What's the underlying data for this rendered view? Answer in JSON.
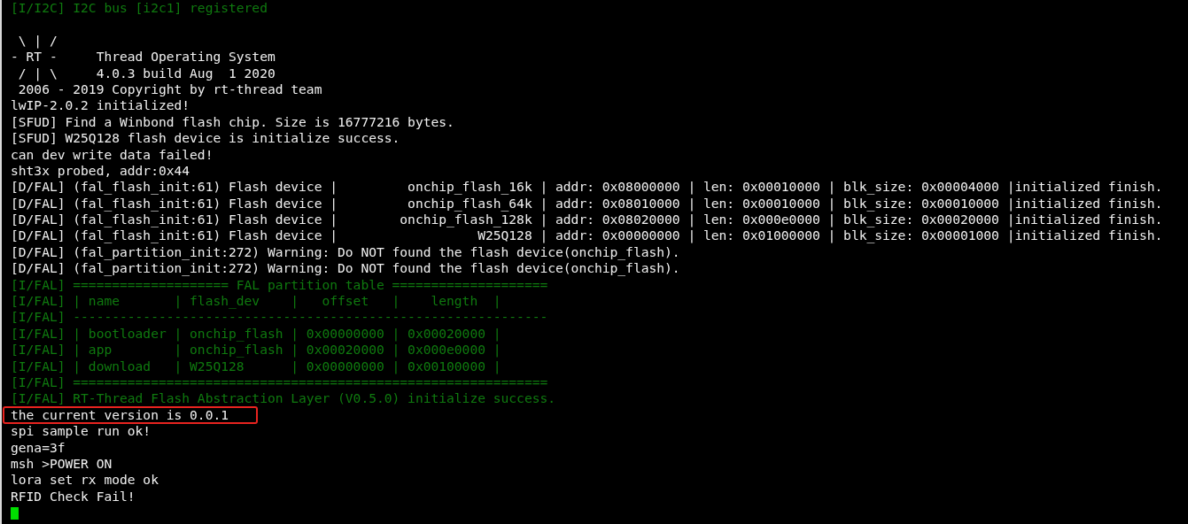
{
  "terminal": {
    "lines": [
      {
        "kind": "info",
        "text": "[I/I2C] I2C bus [i2c1] registered",
        "highlighted": false
      },
      {
        "kind": "blank"
      },
      {
        "kind": "output",
        "text": " \\ | /",
        "highlighted": false
      },
      {
        "kind": "output",
        "text": "- RT -     Thread Operating System",
        "highlighted": false
      },
      {
        "kind": "output",
        "text": " / | \\     4.0.3 build Aug  1 2020",
        "highlighted": false
      },
      {
        "kind": "output",
        "text": " 2006 - 2019 Copyright by rt-thread team",
        "highlighted": false
      },
      {
        "kind": "output",
        "text": "lwIP-2.0.2 initialized!",
        "highlighted": false
      },
      {
        "kind": "output",
        "text": "[SFUD] Find a Winbond flash chip. Size is 16777216 bytes.",
        "highlighted": false
      },
      {
        "kind": "output",
        "text": "[SFUD] W25Q128 flash device is initialize success.",
        "highlighted": false
      },
      {
        "kind": "output",
        "text": "can dev write data failed!",
        "highlighted": false
      },
      {
        "kind": "output",
        "text": "sht3x probed, addr:0x44",
        "highlighted": false
      },
      {
        "kind": "output",
        "text": "[D/FAL] (fal_flash_init:61) Flash device |         onchip_flash_16k | addr: 0x08000000 | len: 0x00010000 | blk_size: 0x00004000 |initialized finish.",
        "highlighted": false
      },
      {
        "kind": "output",
        "text": "[D/FAL] (fal_flash_init:61) Flash device |         onchip_flash_64k | addr: 0x08010000 | len: 0x00010000 | blk_size: 0x00010000 |initialized finish.",
        "highlighted": false
      },
      {
        "kind": "output",
        "text": "[D/FAL] (fal_flash_init:61) Flash device |        onchip_flash_128k | addr: 0x08020000 | len: 0x000e0000 | blk_size: 0x00020000 |initialized finish.",
        "highlighted": false
      },
      {
        "kind": "output",
        "text": "[D/FAL] (fal_flash_init:61) Flash device |                  W25Q128 | addr: 0x00000000 | len: 0x01000000 | blk_size: 0x00001000 |initialized finish.",
        "highlighted": false
      },
      {
        "kind": "output",
        "text": "[D/FAL] (fal_partition_init:272) Warning: Do NOT found the flash device(onchip_flash).",
        "highlighted": false
      },
      {
        "kind": "output",
        "text": "[D/FAL] (fal_partition_init:272) Warning: Do NOT found the flash device(onchip_flash).",
        "highlighted": false
      },
      {
        "kind": "info",
        "text": "[I/FAL] ==================== FAL partition table ====================",
        "highlighted": false
      },
      {
        "kind": "info",
        "text": "[I/FAL] | name       | flash_dev    |   offset   |    length  |",
        "highlighted": false
      },
      {
        "kind": "info",
        "text": "[I/FAL] -------------------------------------------------------------",
        "highlighted": false
      },
      {
        "kind": "info",
        "text": "[I/FAL] | bootloader | onchip_flash | 0x00000000 | 0x00020000 |",
        "highlighted": false
      },
      {
        "kind": "info",
        "text": "[I/FAL] | app        | onchip_flash | 0x00020000 | 0x000e0000 |",
        "highlighted": false
      },
      {
        "kind": "info",
        "text": "[I/FAL] | download   | W25Q128      | 0x00000000 | 0x00100000 |",
        "highlighted": false
      },
      {
        "kind": "info",
        "text": "[I/FAL] =============================================================",
        "highlighted": false
      },
      {
        "kind": "info",
        "text": "[I/FAL] RT-Thread Flash Abstraction Layer (V0.5.0) initialize success.",
        "highlighted": false
      },
      {
        "kind": "output",
        "text": "the current version is 0.0.1",
        "highlighted": true
      },
      {
        "kind": "output",
        "text": "spi sample run ok!",
        "highlighted": false
      },
      {
        "kind": "output",
        "text": "gena=3f",
        "highlighted": false
      },
      {
        "kind": "output",
        "text": "msh >POWER ON",
        "highlighted": false
      },
      {
        "kind": "output",
        "text": "lora set rx mode ok",
        "highlighted": false
      },
      {
        "kind": "output",
        "text": "RFID Check Fail!",
        "highlighted": false
      },
      {
        "kind": "cursor"
      }
    ]
  }
}
